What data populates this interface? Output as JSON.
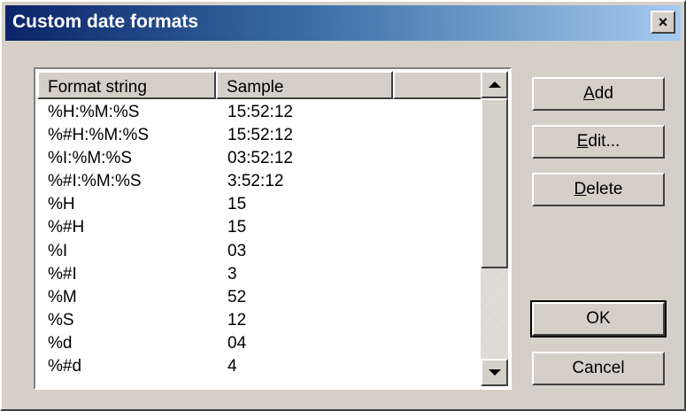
{
  "window": {
    "title": "Custom date formats",
    "close_glyph": "×"
  },
  "list": {
    "columns": [
      "Format string",
      "Sample"
    ],
    "rows": [
      {
        "format": "%H:%M:%S",
        "sample": "15:52:12"
      },
      {
        "format": "%#H:%M:%S",
        "sample": "15:52:12"
      },
      {
        "format": "%I:%M:%S",
        "sample": "03:52:12"
      },
      {
        "format": "%#I:%M:%S",
        "sample": "3:52:12"
      },
      {
        "format": "%H",
        "sample": "15"
      },
      {
        "format": "%#H",
        "sample": "15"
      },
      {
        "format": "%I",
        "sample": "03"
      },
      {
        "format": "%#I",
        "sample": "3"
      },
      {
        "format": "%M",
        "sample": "52"
      },
      {
        "format": "%S",
        "sample": "12"
      },
      {
        "format": "%d",
        "sample": "04"
      },
      {
        "format": "%#d",
        "sample": "4"
      }
    ]
  },
  "buttons": {
    "add": {
      "mnemonic": "A",
      "rest": "dd"
    },
    "edit": {
      "mnemonic": "E",
      "rest": "dit..."
    },
    "delete": {
      "mnemonic": "D",
      "rest": "elete"
    },
    "ok": "OK",
    "cancel": "Cancel"
  },
  "colors": {
    "title_gradient_start": "#0a246a",
    "title_gradient_end": "#a6caf0",
    "face": "#d4d0c8"
  }
}
